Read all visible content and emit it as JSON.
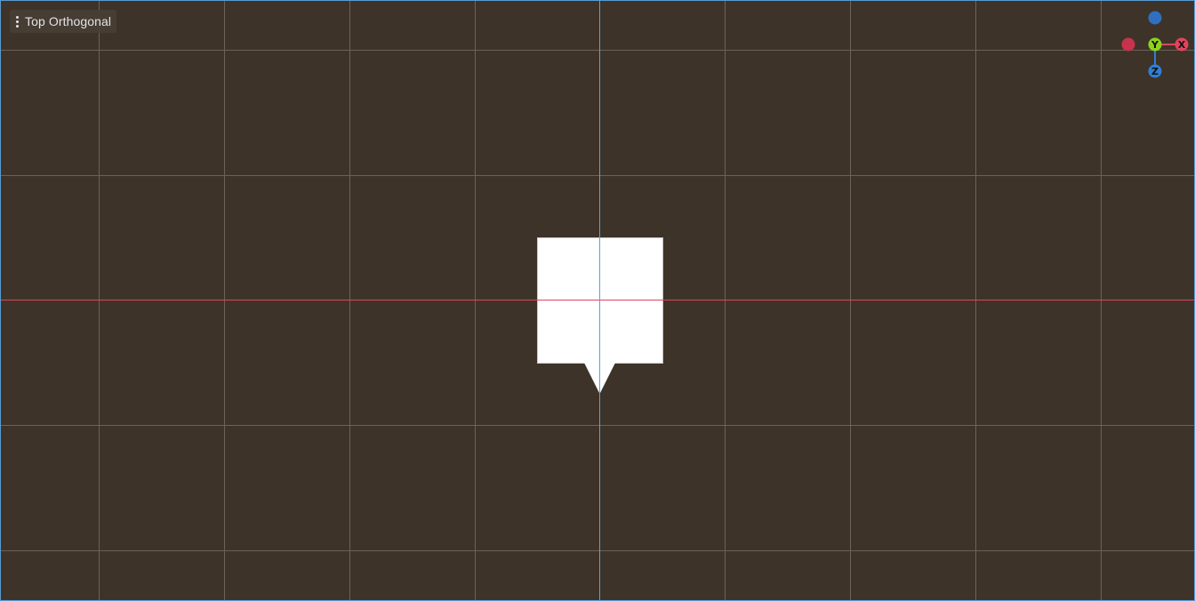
{
  "viewport": {
    "view_menu_label": "Top Orthogonal",
    "colors": {
      "background": "#3d3329",
      "grid_line": "#6b625a",
      "x_axis": "#e0445e",
      "z_axis": "#4aa8e8",
      "viewport_border": "#5a9bd3",
      "camera_icon": "#ffffff"
    }
  },
  "gizmo": {
    "x_label": "X",
    "y_label": "Y",
    "z_label": "Z",
    "colors": {
      "x": "#e0445e",
      "y": "#8ed21c",
      "z": "#2f7fd6",
      "neg_x": "#c8324e",
      "neg_y": "#2f6fbf"
    }
  },
  "icons": {
    "view_menu": "kebab-menu-icon",
    "camera": "camera-gizmo-icon"
  }
}
